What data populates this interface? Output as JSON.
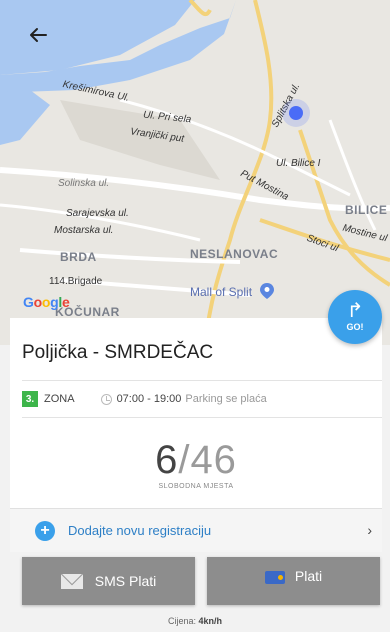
{
  "map": {
    "streets": [
      "Krešimirova Ul.",
      "Ul. Pri sela",
      "Vranjički put",
      "Splitska ul.",
      "Ul. Bilice I",
      "Put Mostina",
      "Solinska ul.",
      "Sarajevska ul.",
      "Mostarska ul.",
      "Mostine ul",
      "Stoci ul",
      "114.Brigade"
    ],
    "areas": [
      "BILICE",
      "BRDA",
      "NESLANOVAC",
      "KOČUNAR"
    ],
    "poi": "Mall of Split",
    "attribution": [
      "G",
      "o",
      "o",
      "g",
      "l",
      "e"
    ],
    "icons": {
      "back": "back-arrow-icon",
      "location": "current-location-icon",
      "poi": "map-pin-icon"
    }
  },
  "go_button": {
    "label": "GO!",
    "icon": "turn-right-icon"
  },
  "parking": {
    "title": "Poljička - SMRDEČAC",
    "zone_number": "3.",
    "zone_label": "ZONA",
    "zone_color": "#3db54a",
    "hours": "07:00 - 19:00",
    "parking_note": "Parking se plaća",
    "free_spots": "6",
    "separator": "/",
    "total_spots": "46",
    "caption": "SLOBODNA MJESTA"
  },
  "registration": {
    "label": "Dodajte novu registraciju",
    "chevron": "›",
    "plus": "+"
  },
  "buttons": {
    "sms": "SMS Plati",
    "pay": "Plati"
  },
  "price": {
    "label": "Cijena:",
    "value": "4kn/h"
  },
  "colors": {
    "accent": "#3aa0ea",
    "button_bg": "#8d8d8d",
    "link": "#2d7fc6"
  }
}
